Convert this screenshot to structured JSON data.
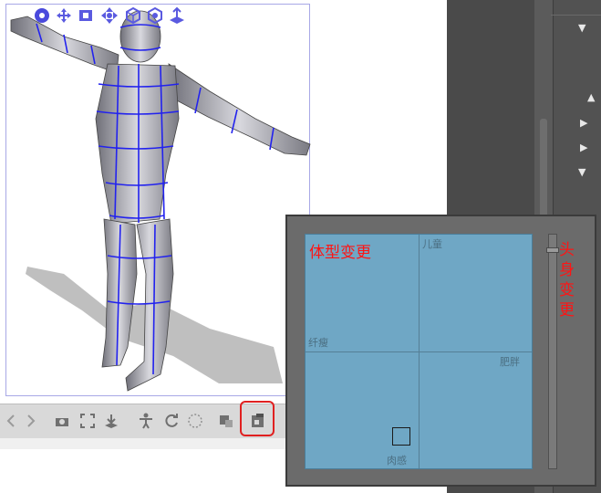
{
  "body_shape_panel": {
    "title": "体型变更",
    "labels": {
      "top": "儿童",
      "left": "纤瘦",
      "right": "肥胖",
      "bottom": "肉感"
    },
    "head_ratio_title": "头身变更"
  },
  "colors": {
    "pad_background": "#6fa7c5",
    "annotation_red": "#ff1414",
    "highlight_border": "#e02020"
  },
  "icons": {
    "gizmo_toolbar": [
      "rotate-camera-icon",
      "move-icon",
      "pan-icon",
      "move-object-icon",
      "rotate-object-icon",
      "object-rotate-icon",
      "floor-move-icon"
    ],
    "bottom_toolbar": [
      "prev-icon",
      "next-icon",
      "camera-icon",
      "fit-icon",
      "drop-icon",
      "pose-icon",
      "reset-pose-icon",
      "lock-joint-icon",
      "register-pose-icon",
      "body-shape-icon"
    ]
  }
}
